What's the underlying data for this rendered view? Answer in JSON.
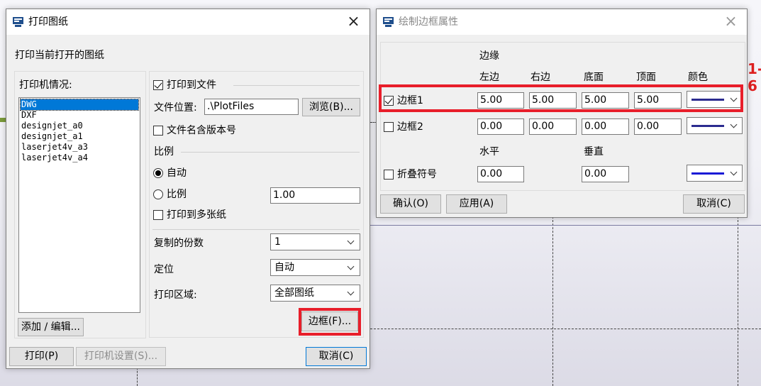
{
  "colors": {
    "accent": "#0078d7",
    "highlight_box": "#e81e2a",
    "line_color_1": "#2b2b8f",
    "line_color_2": "#2b2b8f",
    "line_color_fold": "#1a1ad6"
  },
  "icons": [
    "app-icon",
    "close-icon",
    "chevron-down-icon"
  ],
  "background": {
    "edge_text": "1-6"
  },
  "print_dialog": {
    "title": "打印图纸",
    "header": "打印当前打开的图纸",
    "printer_group_label": "打印机情况:",
    "printers": [
      "DWG",
      "DXF",
      "designjet_a0",
      "designjet_a1",
      "laserjet4v_a3",
      "laserjet4v_a4"
    ],
    "add_edit_label": "添加 / 编辑...",
    "print_to_file": {
      "label": "打印到文件",
      "checked": true
    },
    "file_location": {
      "label": "文件位置:",
      "value": ".\\PlotFiles"
    },
    "browse_label": "浏览(B)...",
    "include_version": {
      "label": "文件名含版本号",
      "checked": false
    },
    "scale": {
      "label": "比例",
      "auto_label": "自动",
      "ratio_label": "比例",
      "ratio_value": "1.00",
      "selected": "自动"
    },
    "multi_sheet": {
      "label": "打印到多张纸",
      "checked": false
    },
    "copies": {
      "label": "复制的份数",
      "value": "1"
    },
    "orientation": {
      "label": "定位",
      "value": "自动"
    },
    "area": {
      "label": "打印区域:",
      "value": "全部图纸"
    },
    "border_button_label": "边框(F)...",
    "print_button_label": "打印(P)",
    "printer_settings_label": "打印机设置(S)...",
    "cancel_label": "取消(C)"
  },
  "border_dialog": {
    "title": "绘制边框属性",
    "margin_header": "边缘",
    "columns": [
      "左边",
      "右边",
      "底面",
      "顶面",
      "颜色"
    ],
    "rows": [
      {
        "label": "边框1",
        "checked": true,
        "left": "5.00",
        "right": "5.00",
        "bottom": "5.00",
        "top": "5.00"
      },
      {
        "label": "边框2",
        "checked": false,
        "left": "0.00",
        "right": "0.00",
        "bottom": "0.00",
        "top": "0.00"
      }
    ],
    "horizontal_label": "水平",
    "vertical_label": "垂直",
    "fold": {
      "label": "折叠符号",
      "checked": false,
      "horizontal": "0.00",
      "vertical": "0.00"
    },
    "ok_label": "确认(O)",
    "apply_label": "应用(A)",
    "cancel_label": "取消(C)"
  }
}
